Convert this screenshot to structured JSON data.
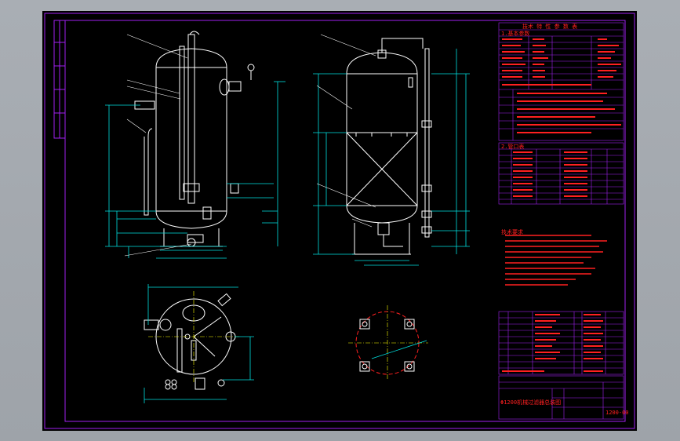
{
  "drawing": {
    "params_table_title": "技术 特 性 参 数 表",
    "params_table_header": "1.基本参数",
    "nozzle_table_header": "2.管口表",
    "tech_requirements_header": "技术要求",
    "drawing_title": "Φ1200机械过滤器总装图",
    "drawing_number": "1200-00"
  },
  "colors": {
    "background": "#000000",
    "frame": "#a020f0",
    "geometry": "#ffffff",
    "dimensions": "#00e0e0",
    "text": "#ff2020",
    "centerline": "#ffff00"
  },
  "icons": [
    "pressure-gauge-icon",
    "drain-valve-icon",
    "manhole-icon",
    "pipe-flange-icon"
  ]
}
